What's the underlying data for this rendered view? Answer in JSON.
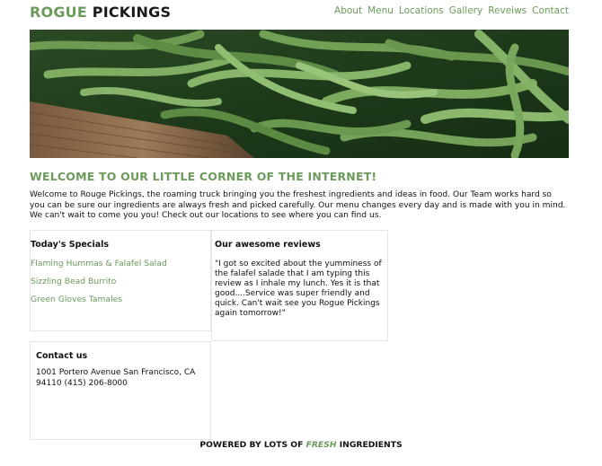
{
  "header": {
    "logo_part1": "ROGUE",
    "logo_part2": "PICKINGS",
    "nav": [
      "About",
      "Menu",
      "Locations",
      "Gallery",
      "Reveiws",
      "Contact"
    ]
  },
  "hero": {
    "image": "green-beans-photo"
  },
  "welcome": {
    "title": "WELCOME TO OUR LITTLE CORNER OF THE INTERNET!",
    "body": "Welcome to Rouge Pickings, the roaming truck bringing you the freshest ingredients and ideas in food. Our Team works hard so you can be sure our ingredients are always fresh and picked carefully. Our menu changes every day and is made with you in mind. We can't wait to come you you! Check out our locations to see where you can find us."
  },
  "specials": {
    "title": "Today's Specials",
    "items": [
      "Flaming Hummas & Falafel Salad",
      "Sizzling Bead Burrito",
      "Green Gloves Tamales"
    ]
  },
  "reviews": {
    "title": "Our awesome reviews",
    "text": "\"I got so excited about the yumminess of the falafel salade that I am typing this review as I inhale my lunch. Yes it is that good....Service was super friendly and quick. Can't wait see you Rogue Pickings again tomorrow!\""
  },
  "contact": {
    "title": "Contact us",
    "text": "1001 Portero Avenue San Francisco, CA 94110 (415) 206-8000"
  },
  "footer": {
    "prefix": "POWERED BY LOTS OF",
    "fresh": "FRESH",
    "suffix": "INGREDIENTS"
  },
  "colors": {
    "accent": "#6b9a5a",
    "text": "#111111"
  }
}
